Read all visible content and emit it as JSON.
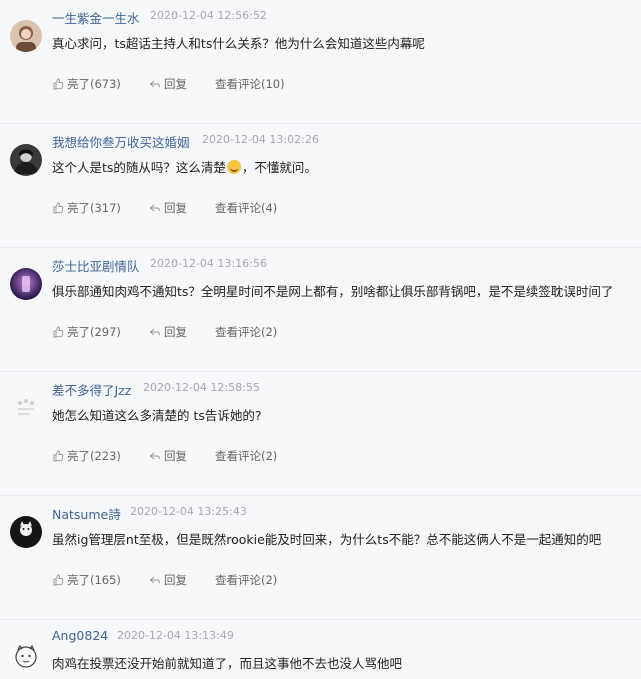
{
  "comments": [
    {
      "user": "一生紫金一生水",
      "time": "2020-12-04 12:56:52",
      "text": "真心求问，ts超话主持人和ts什么关系？他为什么会知道这些内幕呢",
      "like_label": "亮了(673)",
      "reply_label": "回复",
      "view_label": "查看评论(10)",
      "avatar_color": "#b98a6c"
    },
    {
      "user": "我想给你叁万收买这婚姻",
      "time": "2020-12-04 13:02:26",
      "text_before": "这个人是ts的随从吗？这么清楚",
      "text_after": "，不懂就问。",
      "like_label": "亮了(317)",
      "reply_label": "回复",
      "view_label": "查看评论(4)",
      "avatar_color": "#2b2b2b"
    },
    {
      "user": "莎士比亚剧情队",
      "time": "2020-12-04 13:16:56",
      "text": "俱乐部通知肉鸡不通知ts？全明星时间不是网上都有，别啥都让俱乐部背锅吧，是不是续签耽误时间了",
      "like_label": "亮了(297)",
      "reply_label": "回复",
      "view_label": "查看评论(2)",
      "avatar_color": "#3b2a6e"
    },
    {
      "user": "差不多得了Jzz",
      "time": "2020-12-04 12:58:55",
      "text": "她怎么知道这么多清楚的 ts告诉她的?",
      "like_label": "亮了(223)",
      "reply_label": "回复",
      "view_label": "查看评论(2)",
      "avatar_color": "#dcdcdc"
    },
    {
      "user": "Natsume詩",
      "time": "2020-12-04 13:25:43",
      "text": "虽然ig管理层nt至极，但是既然rookie能及时回来，为什么ts不能？总不能这俩人不是一起通知的吧",
      "like_label": "亮了(165)",
      "reply_label": "回复",
      "view_label": "查看评论(2)",
      "avatar_color": "#1a1a1a"
    },
    {
      "user": "Ang0824",
      "time": "2020-12-04 13:13:49",
      "text": "肉鸡在投票还没开始前就知道了，而且这事他不去也没人骂他吧",
      "avatar_color": "#eeeeee"
    }
  ]
}
